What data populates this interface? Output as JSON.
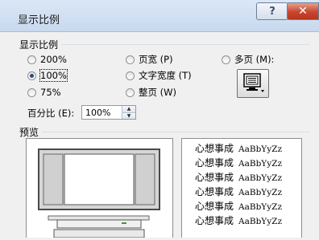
{
  "window": {
    "title": "显示比例",
    "help_label": "?",
    "close_label": "✕"
  },
  "zoom_group": {
    "label": "显示比例",
    "options": [
      {
        "label": "200%",
        "checked": false
      },
      {
        "label": "100%",
        "checked": true
      },
      {
        "label": "75%",
        "checked": false
      },
      {
        "label": "页宽 (P)",
        "checked": false
      },
      {
        "label": "文字宽度 (T)",
        "checked": false
      },
      {
        "label": "整页 (W)",
        "checked": false
      },
      {
        "label": "多页 (M):",
        "checked": false
      }
    ],
    "multipage_icon": "monitor-pages-icon"
  },
  "percent": {
    "label": "百分比 (E):",
    "value": "100%"
  },
  "preview": {
    "label": "预览",
    "sample_lines": [
      {
        "cn": "心想事成",
        "latin": "AaBbYyZz"
      },
      {
        "cn": "心想事成",
        "latin": "AaBbYyZz"
      },
      {
        "cn": "心想事成",
        "latin": "AaBbYyZz"
      },
      {
        "cn": "心想事成",
        "latin": "AaBbYyZz"
      },
      {
        "cn": "心想事成",
        "latin": "AaBbYyZz"
      },
      {
        "cn": "心想事成",
        "latin": "AaBbYyZz"
      }
    ]
  },
  "colors": {
    "titlebar": "#c8d9ee",
    "close_button": "#c8462d",
    "dialog_bg": "#f0f0f0"
  }
}
